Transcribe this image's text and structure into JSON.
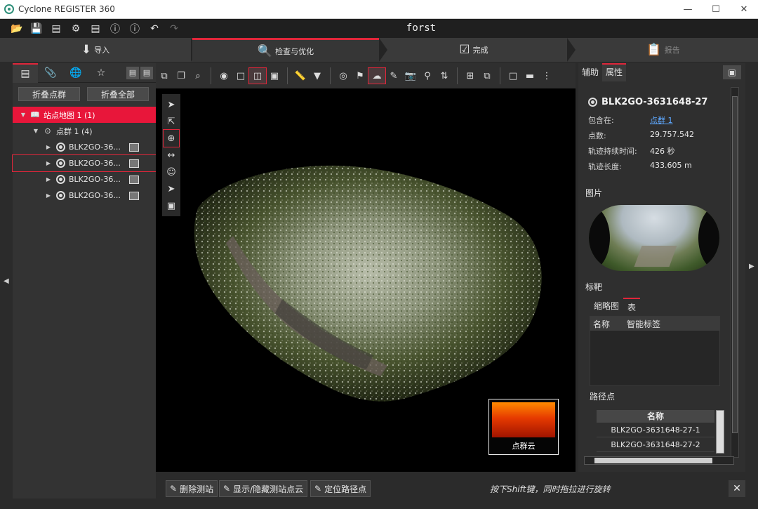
{
  "window": {
    "title": "Cyclone REGISTER 360",
    "minimize": "—",
    "maximize": "☐",
    "close": "✕"
  },
  "project": {
    "name": "forst"
  },
  "workflow": {
    "steps": [
      {
        "label": "导入"
      },
      {
        "label": "检查与优化"
      },
      {
        "label": "完成"
      },
      {
        "label": "报告"
      }
    ]
  },
  "left_panel": {
    "buttons": {
      "collapse_bundles": "折叠点群",
      "collapse_all": "折叠全部"
    },
    "tree": {
      "sitemap": "站点地图 1 (1)",
      "bundle": "点群 1 (4)",
      "setups": [
        "BLK2GO-36...",
        "BLK2GO-36...",
        "BLK2GO-36...",
        "BLK2GO-36..."
      ]
    }
  },
  "viewport": {
    "minimap_label": "点群云"
  },
  "bottom_bar": {
    "delete_setup": "删除测站",
    "toggle_cloud": "显示/隐藏测站点云",
    "locate_waypoint": "定位路径点",
    "hint": "按下Shift键，同时拖拉进行旋转",
    "close": "✕"
  },
  "right_panel": {
    "tabs": {
      "aux": "辅助",
      "properties": "属性"
    },
    "setup_name": "BLK2GO-3631648-27",
    "properties": [
      {
        "key": "包含在:",
        "value": "点群 1",
        "link": true
      },
      {
        "key": "点数:",
        "value": "29.757.542",
        "link": false
      },
      {
        "key": "轨迹持续时间:",
        "value": "426 秒",
        "link": false
      },
      {
        "key": "轨迹长度:",
        "value": "433.605 m",
        "link": false
      }
    ],
    "image_label": "图片",
    "targets_label": "标靶",
    "target_tabs": {
      "thumbnail": "缩略图",
      "table": "表"
    },
    "target_columns": {
      "name": "名称",
      "smart_tag": "智能标签"
    },
    "waypoints_label": "路径点",
    "waypoint_column": "名称",
    "waypoints": [
      "BLK2GO-3631648-27-1",
      "BLK2GO-3631648-27-2"
    ]
  },
  "accent_color": "#e0263a"
}
